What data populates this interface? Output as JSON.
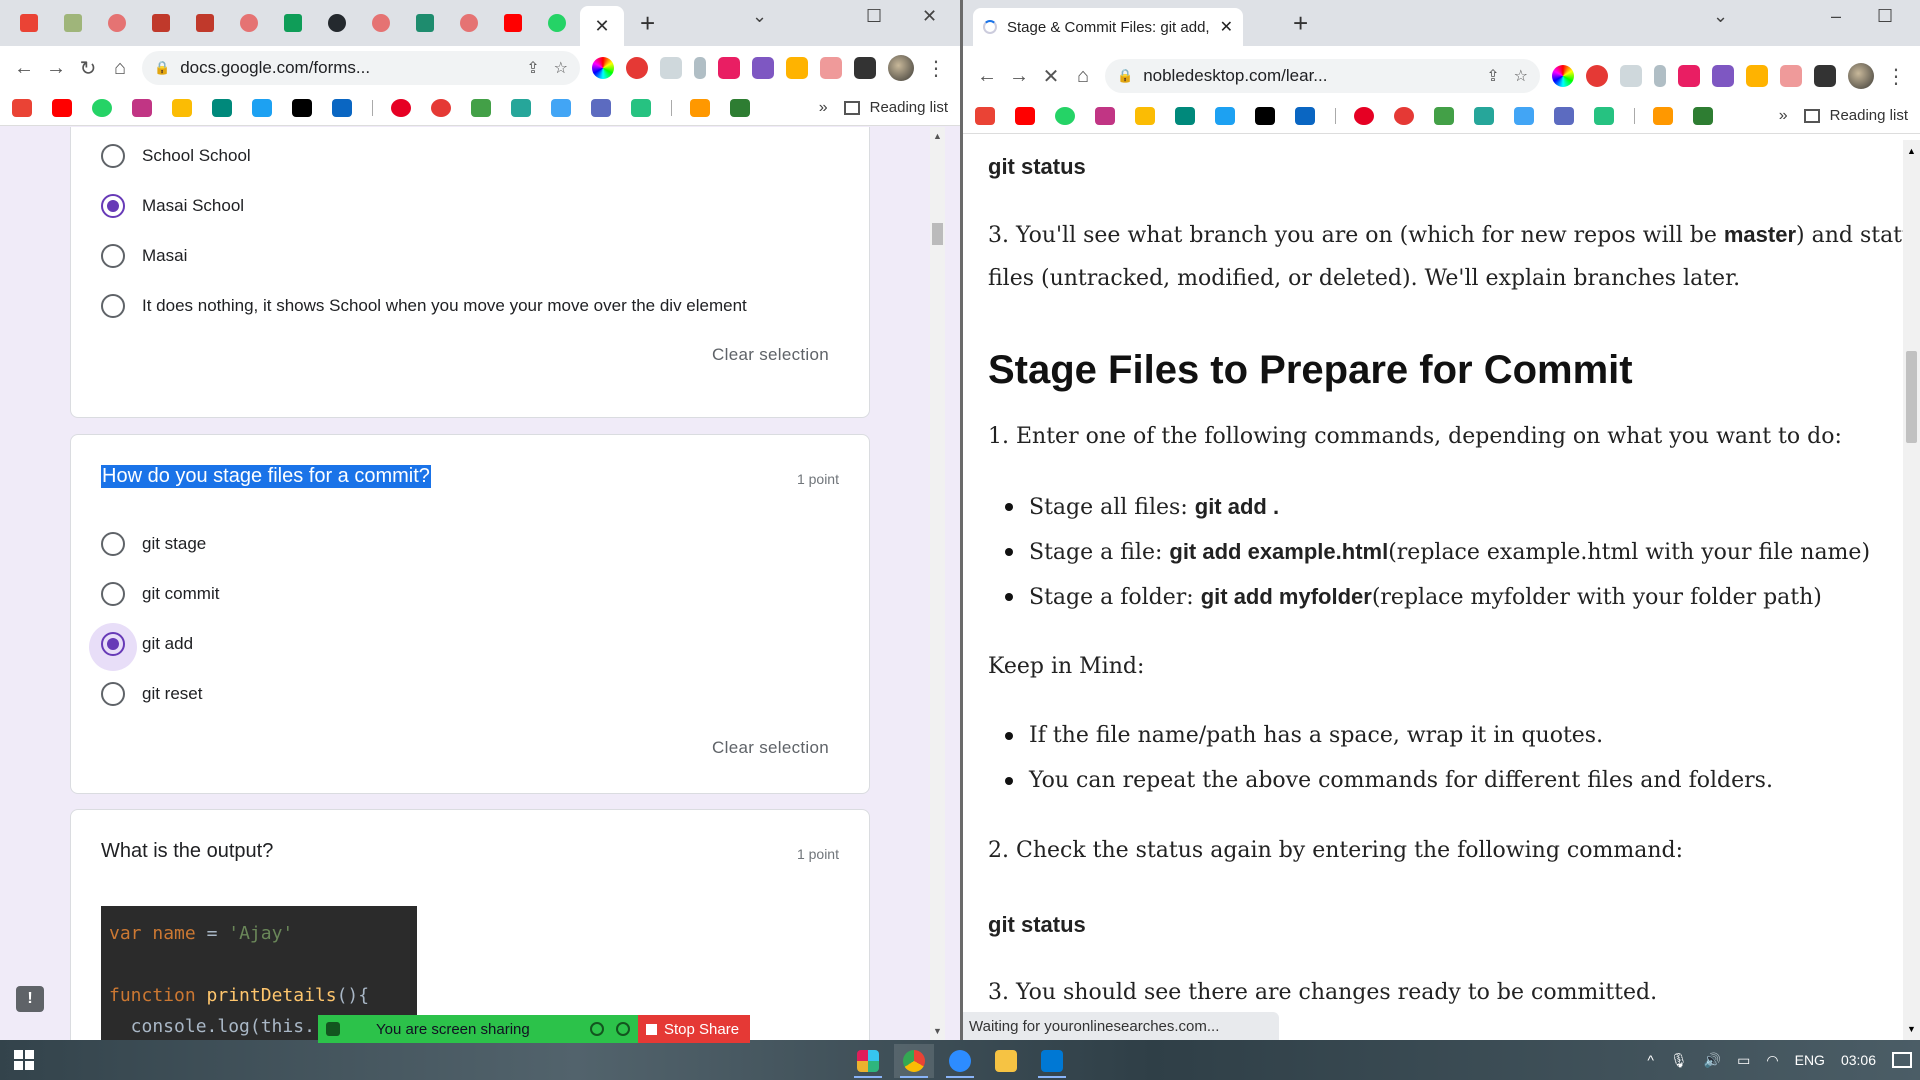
{
  "left_browser": {
    "url": "docs.google.com/forms...",
    "reading_list": "Reading list",
    "q_prev": {
      "options": [
        {
          "label": "School School",
          "selected": false
        },
        {
          "label": "Masai School",
          "selected": true
        },
        {
          "label": "Masai",
          "selected": false
        },
        {
          "label": "It does nothing, it shows School when you move your move over the div element",
          "selected": false
        }
      ],
      "clear": "Clear selection"
    },
    "q_stage": {
      "title": "How do you stage files for a commit?",
      "points": "1 point",
      "options": [
        {
          "label": "git stage",
          "selected": false
        },
        {
          "label": "git commit",
          "selected": false
        },
        {
          "label": "git add",
          "selected": true
        },
        {
          "label": "git reset",
          "selected": false
        }
      ],
      "clear": "Clear selection"
    },
    "q_output": {
      "title": "What is the output?",
      "points": "1 point",
      "code": {
        "l1_kw": "var",
        "l1_name": "name",
        "l1_eq": "=",
        "l1_str": "'Ajay'",
        "l2_kw": "function",
        "l2_fn": "printDetails",
        "l2_rest": "(){",
        "l3": "  console.log(this."
      }
    },
    "feedback": "!"
  },
  "screen_share": {
    "text": "You are screen sharing",
    "stop": "Stop Share",
    "color_bar": "#2cc24a",
    "color_stop": "#e53935"
  },
  "right_browser": {
    "tab_title": "Stage & Commit Files: git add, gi",
    "url": "nobledesktop.com/lear...",
    "reading_list": "Reading list",
    "status_text": "Waiting for youronlinesearches.com...",
    "article": {
      "cmd1": "git status",
      "p3_a": "3. You'll see what branch you are on (which for new repos will be ",
      "p3_b": "master",
      "p3_c": ") and status of",
      "p3_d": "files (untracked, modified, or deleted). We'll explain branches later.",
      "h2": "Stage Files to Prepare for Commit",
      "p1": "1. Enter one of the following commands, depending on what you want to do:",
      "b1_a": "Stage all files: ",
      "b1_b": "git add .",
      "b2_a": "Stage a file: ",
      "b2_b": "git add example.html",
      "b2_c": " (replace example.html with your file name)",
      "b3_a": "Stage a folder: ",
      "b3_b": "git add myfolder",
      "b3_c": " (replace myfolder with your folder path)",
      "keep": "Keep in Mind:",
      "k1": "If the file name/path has a space, wrap it in quotes.",
      "k2": "You can repeat the above commands for different files and folders.",
      "p2": "2. Check the status again by entering the following command:",
      "cmd2": "git status",
      "p3_final": "3. You should see there are changes ready to be committed."
    }
  },
  "taskbar": {
    "lang": "ENG",
    "time": "03:06"
  }
}
